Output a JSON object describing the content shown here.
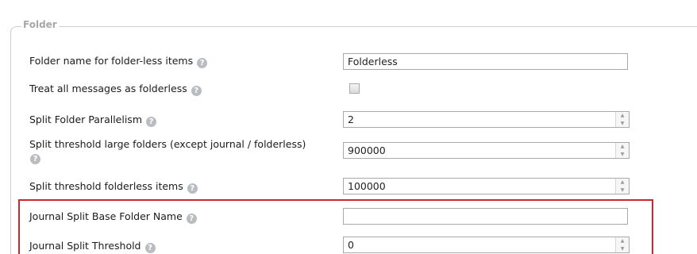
{
  "fieldset": {
    "legend": "Folder"
  },
  "help_glyph": "?",
  "rows": [
    {
      "label": "Folder name for folder-less items",
      "value": "Folderless"
    },
    {
      "label": "Treat all messages as folderless",
      "checked": false
    },
    {
      "label": "Split Folder Parallelism",
      "value": "2"
    },
    {
      "label": "Split threshold large folders (except journal / folderless)",
      "value": "900000"
    },
    {
      "label": "Split threshold folderless items",
      "value": "100000"
    },
    {
      "label": "Journal Split Base Folder Name",
      "value": ""
    },
    {
      "label": "Journal Split Threshold",
      "value": "0"
    }
  ],
  "spinner": {
    "up": "▲",
    "down": "▼"
  },
  "colors": {
    "highlight_border": "#c8292f",
    "legend_text": "#a8a8a8",
    "help_icon": "#b9bcc0"
  }
}
